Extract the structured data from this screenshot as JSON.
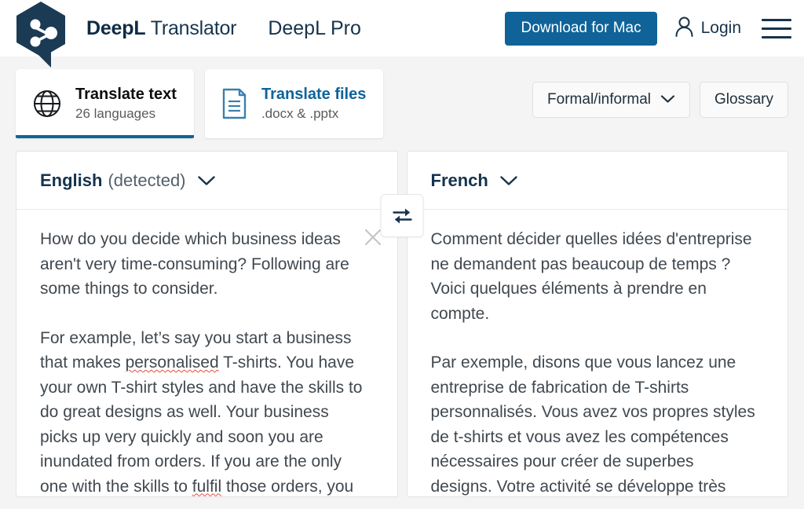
{
  "header": {
    "logo_icon": "deepl-logo-icon",
    "brand_bold": "DeepL",
    "brand_light": "Translator",
    "nav_pro": "DeepL Pro",
    "download_label": "Download for Mac",
    "login_label": "Login",
    "login_icon": "user-icon",
    "menu_icon": "hamburger-menu-icon",
    "accent_blue": "#0f6399",
    "logo_navy": "#1b3a54"
  },
  "tabs": [
    {
      "id": "translate-text",
      "icon": "globe-icon",
      "title": "Translate text",
      "subtitle": "26 languages",
      "active": true
    },
    {
      "id": "translate-files",
      "icon": "document-icon",
      "title": "Translate files",
      "subtitle": ".docx & .pptx",
      "active": false
    }
  ],
  "tools": {
    "formal_label": "Formal/informal",
    "formal_icon": "chevron-down-icon",
    "glossary_label": "Glossary"
  },
  "translator": {
    "swap_icon": "swap-arrows-icon",
    "clear_icon": "close-icon",
    "source": {
      "language": "English",
      "detected_suffix": "(detected)",
      "chevron_icon": "chevron-down-icon",
      "paragraphs": [
        "How do you decide which business ideas aren't very time-consuming? Following are some things to consider.",
        "For example, let’s say you start a business that makes personalised T-shirts. You have your own T-shirt styles and have the skills to do great designs as well. Your business picks up very quickly and soon you are inundated from orders.  If you are the only one with the skills to fulfil those orders, you"
      ],
      "misspelled_words": [
        "personalised",
        "fulfil"
      ]
    },
    "target": {
      "language": "French",
      "chevron_icon": "chevron-down-icon",
      "paragraphs": [
        "Comment décider quelles idées d'entreprise ne demandent pas beaucoup de temps ?\nVoici quelques éléments à prendre en compte.",
        "Par exemple, disons que vous lancez une entreprise de fabrication de T-shirts personnalisés. Vous avez vos propres styles de t-shirts et vous avez les compétences nécessaires pour créer de superbes designs. Votre activité se développe très"
      ]
    }
  }
}
